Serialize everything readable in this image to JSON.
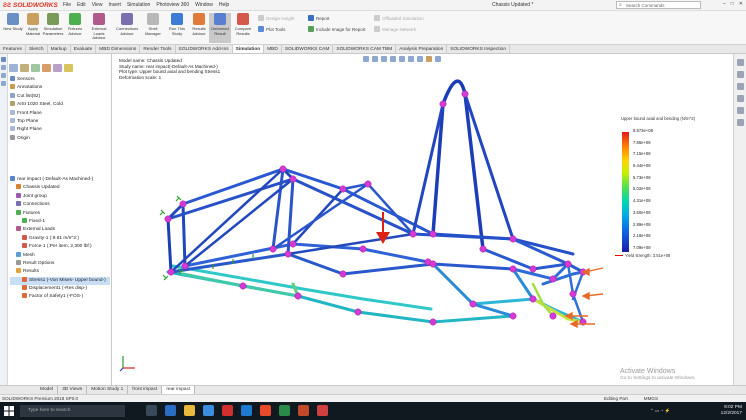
{
  "app": {
    "brand": "SOLIDWORKS",
    "menus": [
      "File",
      "Edit",
      "View",
      "Insert",
      "Simulation",
      "Photoview 360",
      "Window",
      "Help"
    ],
    "document_title": "Chassis Updated *",
    "search_placeholder": "Search Commands"
  },
  "ribbon": {
    "buttons": [
      {
        "label": "New Study"
      },
      {
        "label": "Apply Material"
      },
      {
        "label": "Simulation Parameters"
      },
      {
        "label": "Fixtures Advisor"
      },
      {
        "label": "External Loads Advisor"
      },
      {
        "label": "Connections Advisor"
      },
      {
        "label": "Shell Manager"
      },
      {
        "label": "Run This Study"
      },
      {
        "label": "Results Advisor"
      },
      {
        "label": "Deformed Result"
      },
      {
        "label": "Compare Results"
      }
    ],
    "small_items": [
      "Design Insight",
      "Plot Tools",
      "Report",
      "Include Image for Report",
      "Offloaded Simulation",
      "Manage Network"
    ]
  },
  "tabs": [
    "Features",
    "Sketch",
    "Markup",
    "Evaluate",
    "MBD Dimensions",
    "Render Tools",
    "SOLIDWORKS Add-Ins",
    "Simulation",
    "MBD",
    "SOLIDWORKS CAM",
    "SOLIDWORKS CAM TBM",
    "Analysis Preparation",
    "SOLIDWORKS Inspection"
  ],
  "active_tab": "Simulation",
  "tree": {
    "top": [
      "Sensors",
      "Annotations",
      "Cut list(82)",
      "AISI 1020 Steel, Cold",
      "Front Plane",
      "Top Plane",
      "Right Plane",
      "Origin"
    ],
    "study": [
      {
        "label": "rear impact (-Default-As Machined-)",
        "indent": 0
      },
      {
        "label": "Chassis Updated",
        "indent": 1
      },
      {
        "label": "Joint group",
        "indent": 1
      },
      {
        "label": "Connections",
        "indent": 1
      },
      {
        "label": "Fixtures",
        "indent": 1
      },
      {
        "label": "Fixed-1",
        "indent": 2
      },
      {
        "label": "External Loads",
        "indent": 1
      },
      {
        "label": "Gravity-1 (:9.81 m/s^2:)",
        "indent": 2
      },
      {
        "label": "Force-1 (:Per item: 2,300 lbf:)",
        "indent": 2
      },
      {
        "label": "Mesh",
        "indent": 1
      },
      {
        "label": "Result Options",
        "indent": 1
      },
      {
        "label": "Results",
        "indent": 1
      },
      {
        "label": "Stress1 (-Von Mises- Upper bound-)",
        "indent": 2,
        "selected": true
      },
      {
        "label": "Displacement1 (-Res disp-)",
        "indent": 2
      },
      {
        "label": "Factor of Safety1 (-FOS-)",
        "indent": 2
      }
    ]
  },
  "viewport": {
    "info_lines": [
      "Model name: Chassis Updated",
      "Study name: rear impact(-Default-As Machined-)",
      "Plot type: Upper bound axial and bending Stress1",
      "Deformation scale: 1"
    ],
    "legend_title": "Upper bound axial and bending (N/m^2)",
    "legend_values": [
      "8.573e+08",
      "7.86e+08",
      "7.15e+08",
      "6.44e+08",
      "5.73e+08",
      "5.02e+08",
      "4.31e+08",
      "3.60e+08",
      "2.89e+08",
      "2.18e+08",
      "7.09e+08"
    ],
    "yield_label": "Yield strength: 3.51e+08",
    "watermark_line1": "Activate Windows",
    "watermark_line2": "Go to Settings to activate Windows."
  },
  "bottom_tabs": [
    "Model",
    "3D Views",
    "Motion Study 1",
    "front impact",
    "rear impact"
  ],
  "active_bottom_tab": "rear impact",
  "status": {
    "left": "SOLIDWORKS Premium 2018 SP0.0",
    "editing": "Editing Part",
    "units": "MMGS"
  },
  "taskbar": {
    "search_placeholder": "Type here to search",
    "time": "9:02 PM",
    "date": "12/2/2017"
  },
  "colors": {
    "accent_red": "#d32f2f",
    "active_tab": "#ffffff",
    "selection": "#c7def5"
  }
}
